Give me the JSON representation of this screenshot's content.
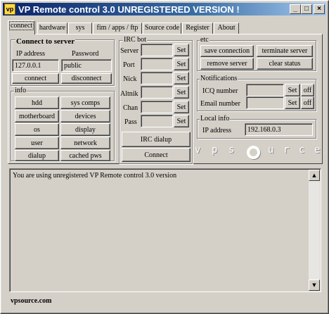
{
  "window": {
    "title": "VP Remote control 3.0  UNREGISTERED VERSION !"
  },
  "titlebar": {
    "minimize": "_",
    "maximize": "□",
    "close": "×"
  },
  "tabs": [
    {
      "label": "connect"
    },
    {
      "label": "hardware"
    },
    {
      "label": "sys"
    },
    {
      "label": "fim / apps / ftp"
    },
    {
      "label": "Source code"
    },
    {
      "label": "Register"
    },
    {
      "label": "About"
    }
  ],
  "connect_server": {
    "title": "Connect to server",
    "ip_label": "IP address",
    "password_label": "Password",
    "ip_value": "127.0.0.1",
    "password_value": "public",
    "connect": "connect",
    "disconnect": "disconnect"
  },
  "info": {
    "title": "info",
    "buttons": [
      [
        "hdd",
        "sys comps"
      ],
      [
        "motherboard",
        "devices"
      ],
      [
        "os",
        "display"
      ],
      [
        "user",
        "network"
      ],
      [
        "dialup",
        "cached pws"
      ]
    ]
  },
  "irc": {
    "title": "IRC bot",
    "rows": [
      {
        "label": "Server",
        "button": "Set"
      },
      {
        "label": "Port",
        "button": "Set"
      },
      {
        "label": "Nick",
        "button": "Set"
      },
      {
        "label": "Altnik",
        "button": "Set"
      },
      {
        "label": "Chan",
        "button": "Set"
      },
      {
        "label": "Pass",
        "button": "Set"
      }
    ],
    "dialup_button": "IRC dialup",
    "connect_button": "Connect"
  },
  "etc": {
    "title": "etc",
    "save_connection": "save connection",
    "terminate_server": "terminate server",
    "remove_server": "remove server",
    "clear_status": "clear status"
  },
  "notifications": {
    "title": "Notifications",
    "icq_label": "ICQ number",
    "email_label": "Email number",
    "set": "Set",
    "off": "off"
  },
  "local_info": {
    "title": "Local info",
    "ip_label": "IP address",
    "ip_value": "192.168.0.3"
  },
  "logo": {
    "letters": [
      "v",
      "p",
      "s",
      "",
      "u",
      "r",
      "c",
      "e"
    ]
  },
  "log": {
    "text": "You are using unregistered VP Remote control 3.0 version"
  },
  "footer": {
    "text": "vpsource.com"
  }
}
